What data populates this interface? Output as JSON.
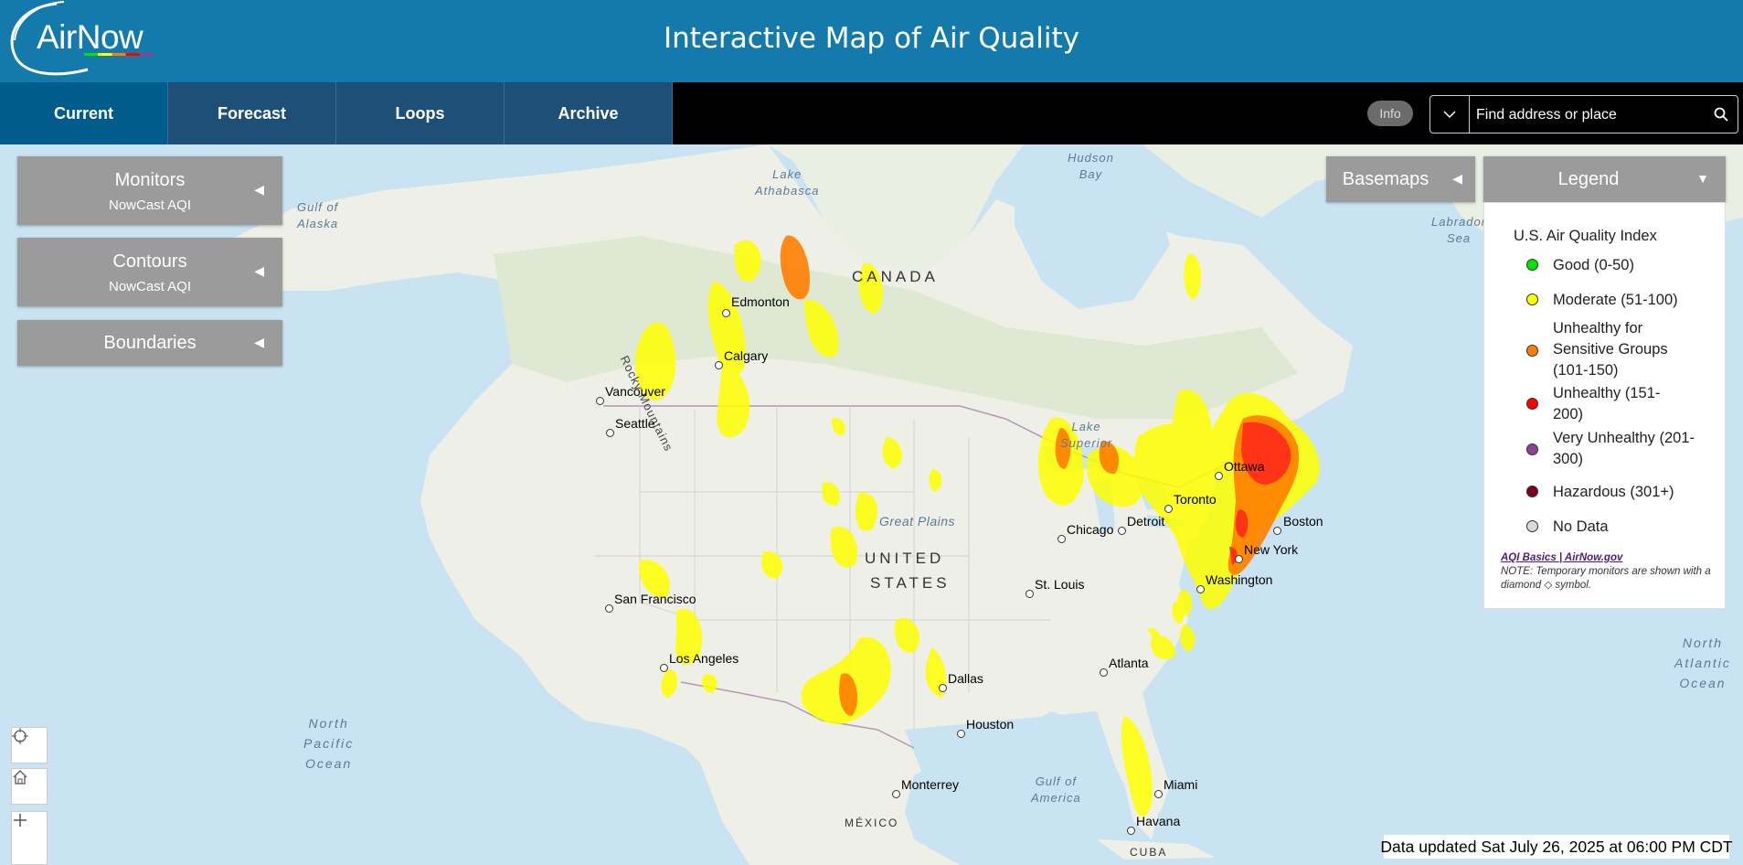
{
  "header": {
    "logo_text": "AirNow",
    "title": "Interactive Map of Air Quality"
  },
  "nav": {
    "tabs": [
      {
        "label": "Current"
      },
      {
        "label": "Forecast"
      },
      {
        "label": "Loops"
      },
      {
        "label": "Archive"
      }
    ]
  },
  "toolbar": {
    "info_label": "Info",
    "search_placeholder": "Find address or place"
  },
  "layers": {
    "monitors": {
      "title": "Monitors",
      "subtitle": "NowCast AQI"
    },
    "contours": {
      "title": "Contours",
      "subtitle": "NowCast AQI"
    },
    "boundaries": {
      "title": "Boundaries"
    },
    "basemaps": {
      "title": "Basemaps"
    }
  },
  "legend": {
    "title": "Legend",
    "heading": "U.S. Air Quality Index",
    "items": [
      {
        "label": "Good (0-50)",
        "color": "#00e400"
      },
      {
        "label": "Moderate (51-100)",
        "color": "#ffff00"
      },
      {
        "label": "Unhealthy for Sensitive Groups (101-150)",
        "color": "#ff7e00"
      },
      {
        "label": "Unhealthy (151-200)",
        "color": "#ff0000"
      },
      {
        "label": "Very Unhealthy (201-300)",
        "color": "#8f3f97"
      },
      {
        "label": "Hazardous (301+)",
        "color": "#7e0023"
      },
      {
        "label": "No Data",
        "color": "#d9d9d9"
      }
    ],
    "link_text": "AQI Basics | AirNow.gov",
    "note_prefix": "NOTE: Temporary monitors are shown with a diamond",
    "note_suffix": "symbol."
  },
  "map": {
    "cities": [
      {
        "name": "Edmonton"
      },
      {
        "name": "Calgary"
      },
      {
        "name": "Vancouver"
      },
      {
        "name": "Seattle"
      },
      {
        "name": "San Francisco"
      },
      {
        "name": "Los Angeles"
      },
      {
        "name": "Dallas"
      },
      {
        "name": "Houston"
      },
      {
        "name": "Monterrey"
      },
      {
        "name": "Chicago"
      },
      {
        "name": "Detroit"
      },
      {
        "name": "Toronto"
      },
      {
        "name": "Ottawa"
      },
      {
        "name": "Boston"
      },
      {
        "name": "New York"
      },
      {
        "name": "Washington"
      },
      {
        "name": "St. Louis"
      },
      {
        "name": "Atlanta"
      },
      {
        "name": "Miami"
      },
      {
        "name": "Havana"
      }
    ],
    "geo_labels": {
      "canada": "CANADA",
      "united": "UNITED",
      "states": "STATES",
      "mexico": "MÉXICO",
      "cuba": "CUBA",
      "great_plains": "Great Plains",
      "rocky_mountains": "Rocky Mountains",
      "lake_athabasca_1": "Lake",
      "lake_athabasca_2": "Athabasca",
      "hudson_bay_1": "Hudson",
      "hudson_bay_2": "Bay",
      "gulf_alaska_1": "Gulf of",
      "gulf_alaska_2": "Alaska",
      "labrador_1": "Labrador",
      "labrador_2": "Sea",
      "lake_superior_1": "Lake",
      "lake_superior_2": "Superior",
      "npo_1": "North",
      "npo_2": "Pacific",
      "npo_3": "Ocean",
      "nao_1": "North",
      "nao_2": "Atlantic",
      "nao_3": "Ocean",
      "gulf_america_1": "Gulf of",
      "gulf_america_2": "America"
    }
  },
  "status": {
    "updated": "Data updated Sat July 26, 2025 at 06:00 PM CDT"
  }
}
